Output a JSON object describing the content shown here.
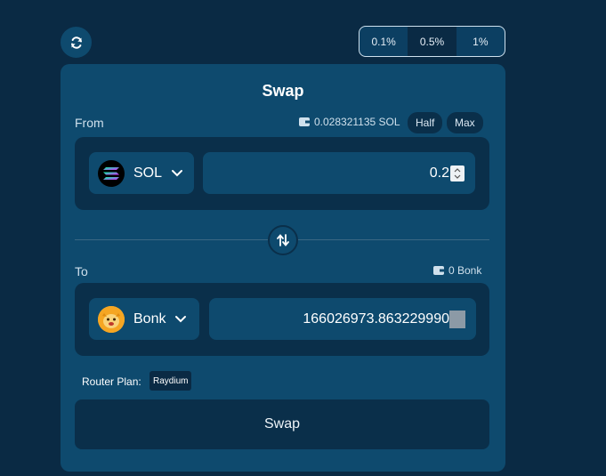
{
  "slippage": {
    "options": [
      "0.1%",
      "0.5%",
      "1%"
    ],
    "selected": "0.5%"
  },
  "card": {
    "title": "Swap",
    "from": {
      "label": "From",
      "balance": "0.028321135 SOL",
      "half_label": "Half",
      "max_label": "Max",
      "token": "SOL",
      "amount": "0.2"
    },
    "to": {
      "label": "To",
      "balance": "0 Bonk",
      "token": "Bonk",
      "amount": "166026973.863229990"
    },
    "router": {
      "label": "Router Plan:",
      "value": "Raydium"
    },
    "swap_button": "Swap"
  },
  "icons": {
    "refresh": "refresh-icon",
    "wallet": "wallet-icon",
    "chevron": "chevron-down-icon",
    "swap_direction": "swap-direction-icon",
    "sol": "sol-logo",
    "bonk": "bonk-logo"
  },
  "colors": {
    "background": "#0a2a44",
    "card": "#0e4a6e",
    "panel": "#0a2f4a"
  }
}
